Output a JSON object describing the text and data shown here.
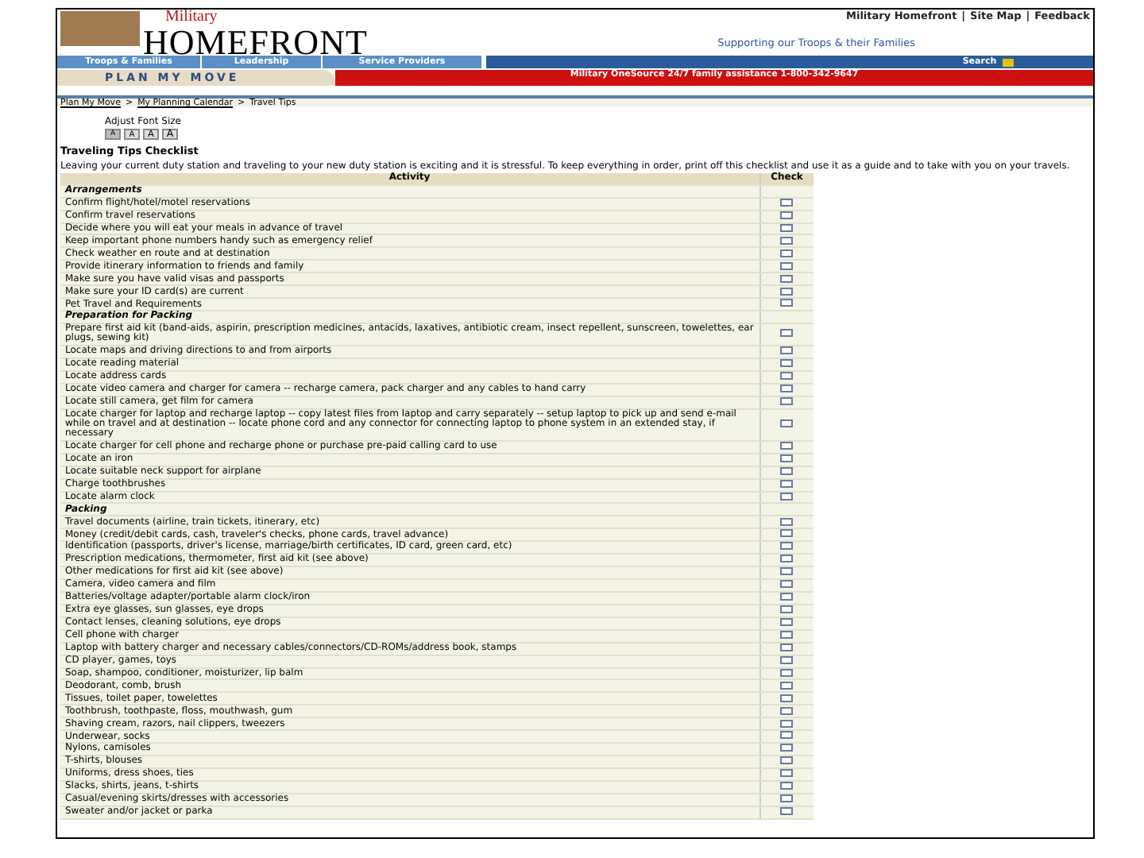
{
  "header": {
    "brand_top": "Military",
    "brand_main": "HOMEFRONT",
    "utility_links": [
      "Military Homefront",
      "Site Map",
      "Feedback"
    ],
    "utility_separator": "|",
    "tagline": "Supporting our Troops & their Families"
  },
  "nav": {
    "tabs": [
      {
        "label": "Troops & Families",
        "selected": false
      },
      {
        "label": "Leadership",
        "selected": false
      },
      {
        "label": "Service Providers",
        "selected": false
      }
    ],
    "search_label": "Search"
  },
  "banner": {
    "section": "PLAN MY MOVE",
    "notice": "Military OneSource 24/7 family assistance 1-800-342-9647"
  },
  "breadcrumb": [
    "Plan My Move",
    "My Planning Calendar",
    "Travel Tips"
  ],
  "breadcrumb_separator": ">",
  "font_size": {
    "label": "Adjust Font Size",
    "buttons": [
      {
        "label": "A",
        "selected": true
      },
      {
        "label": "A",
        "selected": false
      },
      {
        "label": "A",
        "selected": false
      },
      {
        "label": "A",
        "selected": false
      }
    ]
  },
  "title": "Traveling Tips Checklist",
  "intro": "Leaving your current duty station and traveling to your new duty station is exciting and it is stressful. To keep everything in order, print off this checklist and use it as a guide and to take with you on your travels.",
  "table": {
    "columns": [
      "Activity",
      "Check"
    ],
    "sections": [
      {
        "heading": "Arrangements",
        "items": [
          {
            "text": "Confirm flight/hotel/motel reservations",
            "checked": false
          },
          {
            "text": "Confirm travel reservations",
            "checked": false
          },
          {
            "text": "Decide where you will eat your meals in advance of travel",
            "checked": false
          },
          {
            "text": "Keep important phone numbers handy such as emergency relief",
            "checked": false
          },
          {
            "text": "Check weather en route and at destination",
            "checked": false
          },
          {
            "text": "Provide itinerary information to friends and family",
            "checked": false
          },
          {
            "text": "Make sure you have valid visas and passports",
            "checked": false
          },
          {
            "text": "Make sure your ID card(s) are current",
            "checked": false
          },
          {
            "text": "Pet Travel and Requirements",
            "checked": false
          }
        ]
      },
      {
        "heading": "Preparation for Packing",
        "items": [
          {
            "text": "Prepare first aid kit (band-aids, aspirin, prescription medicines, antacids, laxatives, antibiotic cream, insect repellent, sunscreen, towelettes, ear plugs, sewing kit)",
            "checked": false
          },
          {
            "text": "Locate maps and driving directions to and from airports",
            "checked": false
          },
          {
            "text": "Locate reading material",
            "checked": false
          },
          {
            "text": "Locate address cards",
            "checked": false
          },
          {
            "text": "Locate video camera and charger for camera -- recharge camera, pack charger and any cables to hand carry",
            "checked": false
          },
          {
            "text": "Locate still camera, get film for camera",
            "checked": false
          },
          {
            "text": "Locate charger for laptop and recharge laptop -- copy latest files from laptop and carry separately -- setup laptop to pick up and send e-mail while on travel and at destination -- locate phone cord and any connector for connecting laptop to phone system in an extended stay, if necessary",
            "checked": false
          },
          {
            "text": "Locate charger for cell phone and recharge phone or purchase pre-paid calling card to use",
            "checked": false
          },
          {
            "text": "Locate an iron",
            "checked": false
          },
          {
            "text": "Locate suitable neck support for airplane",
            "checked": false
          },
          {
            "text": "Charge toothbrushes",
            "checked": false
          },
          {
            "text": "Locate alarm clock",
            "checked": false
          }
        ]
      },
      {
        "heading": "Packing",
        "items": [
          {
            "text": "Travel documents (airline, train tickets, itinerary, etc)",
            "checked": false
          },
          {
            "text": "Money (credit/debit cards, cash, traveler's checks, phone cards, travel advance)",
            "checked": false
          },
          {
            "text": "Identification (passports, driver's license, marriage/birth certificates, ID card, green card, etc)",
            "checked": false
          },
          {
            "text": "Prescription medications, thermometer, first aid kit (see above)",
            "checked": false
          },
          {
            "text": "Other medications for first aid kit (see above)",
            "checked": false
          },
          {
            "text": "Camera, video camera and film",
            "checked": false
          },
          {
            "text": "Batteries/voltage adapter/portable alarm clock/iron",
            "checked": false
          },
          {
            "text": "Extra eye glasses, sun glasses, eye drops",
            "checked": false
          },
          {
            "text": "Contact lenses, cleaning solutions, eye drops",
            "checked": false
          },
          {
            "text": "Cell phone with charger",
            "checked": false
          },
          {
            "text": "Laptop with battery charger and necessary cables/connectors/CD-ROMs/address book, stamps",
            "checked": false
          },
          {
            "text": "CD player, games, toys",
            "checked": false
          },
          {
            "text": "Soap, shampoo, conditioner, moisturizer, lip balm",
            "checked": false
          },
          {
            "text": "Deodorant, comb, brush",
            "checked": false
          },
          {
            "text": "Tissues, toilet paper, towelettes",
            "checked": false
          },
          {
            "text": "Toothbrush, toothpaste, floss, mouthwash, gum",
            "checked": false
          },
          {
            "text": "Shaving cream, razors, nail clippers, tweezers",
            "checked": false
          },
          {
            "text": "Underwear, socks",
            "checked": false
          },
          {
            "text": "Nylons, camisoles",
            "checked": false
          },
          {
            "text": "T-shirts, blouses",
            "checked": false
          },
          {
            "text": "Uniforms, dress shoes, ties",
            "checked": false
          },
          {
            "text": "Slacks, shirts, jeans, t-shirts",
            "checked": false
          },
          {
            "text": "Casual/evening skirts/dresses with accessories",
            "checked": false
          },
          {
            "text": "Sweater and/or jacket or parka",
            "checked": false
          }
        ]
      }
    ]
  }
}
